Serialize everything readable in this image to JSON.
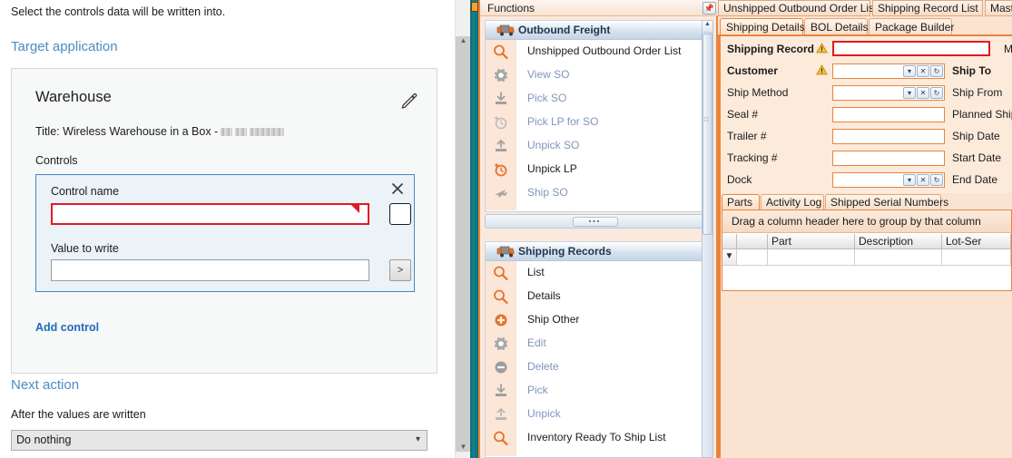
{
  "left_pane": {
    "intro_text": "Select the controls data will be written into.",
    "target_application_heading": "Target application",
    "card": {
      "title": "Warehouse",
      "edit_icon": "pencil-icon",
      "subtitle_prefix": "Title:  Wireless Warehouse in a Box -",
      "controls_label": "Controls",
      "control": {
        "close_icon": "close-x-icon",
        "name_label": "Control name",
        "name_value": "",
        "name_placeholder": "",
        "picker_button_icon": "element-picker-icon",
        "value_label": "Value to write",
        "value_value": "",
        "value_placeholder": "",
        "expand_button_label": ">"
      },
      "add_control_link": "Add control"
    },
    "next_action_heading": "Next action",
    "after_values_label": "After the values are written",
    "next_action_selected": "Do nothing",
    "next_action_options": [
      "Do nothing"
    ]
  },
  "functions_panel": {
    "title": "Functions",
    "pin_icon": "pin-icon",
    "groups": [
      {
        "title": "Outbound Freight",
        "icon": "truck-icon",
        "items": [
          {
            "label": "Unshipped Outbound Order List",
            "icon": "search-icon",
            "enabled": true
          },
          {
            "label": "View SO",
            "icon": "gear-icon",
            "enabled": false
          },
          {
            "label": "Pick SO",
            "icon": "download-tray-icon",
            "enabled": false
          },
          {
            "label": "Pick LP for SO",
            "icon": "clock-plus-icon",
            "enabled": false
          },
          {
            "label": "Unpick SO",
            "icon": "upload-tray-icon",
            "enabled": false
          },
          {
            "label": "Unpick LP",
            "icon": "clock-plus-icon",
            "enabled": true
          },
          {
            "label": "Ship SO",
            "icon": "airplane-icon",
            "enabled": false
          }
        ]
      },
      {
        "title": "Shipping Records",
        "icon": "truck-icon",
        "items": [
          {
            "label": "List",
            "icon": "search-icon",
            "enabled": true
          },
          {
            "label": "Details",
            "icon": "search-icon",
            "enabled": true
          },
          {
            "label": "Ship Other",
            "icon": "plus-circle-icon",
            "enabled": true
          },
          {
            "label": "Edit",
            "icon": "gear-icon",
            "enabled": false
          },
          {
            "label": "Delete",
            "icon": "minus-circle-icon",
            "enabled": false
          },
          {
            "label": "Pick",
            "icon": "download-tray-icon",
            "enabled": false
          },
          {
            "label": "Unpick",
            "icon": "upload-tray-icon",
            "enabled": false
          },
          {
            "label": "Inventory Ready To Ship List",
            "icon": "search-icon",
            "enabled": true
          }
        ]
      }
    ],
    "collapse_grip": "▪▪▪",
    "scroll_up_icon": "chevron-up-icon"
  },
  "right_panel": {
    "document_tabs": [
      {
        "label": "Unshipped Outbound Order List",
        "active": false
      },
      {
        "label": "Shipping Record List",
        "active": false
      },
      {
        "label": "Master Shi",
        "active": false
      }
    ],
    "inner_tabs": [
      {
        "label": "Shipping Details",
        "active": true
      },
      {
        "label": "BOL Details",
        "active": false
      },
      {
        "label": "Package Builder",
        "active": false
      }
    ],
    "form_left": [
      {
        "label": "Shipping Record",
        "bold": true,
        "warn": true,
        "type": "text-required",
        "value": ""
      },
      {
        "label": "Customer",
        "bold": true,
        "warn": true,
        "type": "lookup",
        "value": ""
      },
      {
        "label": "Ship Method",
        "bold": false,
        "warn": false,
        "type": "lookup",
        "value": ""
      },
      {
        "label": "Seal #",
        "bold": false,
        "warn": false,
        "type": "text",
        "value": ""
      },
      {
        "label": "Trailer #",
        "bold": false,
        "warn": false,
        "type": "text",
        "value": ""
      },
      {
        "label": "Tracking #",
        "bold": false,
        "warn": false,
        "type": "text",
        "value": ""
      },
      {
        "label": "Dock",
        "bold": false,
        "warn": false,
        "type": "lookup",
        "value": ""
      }
    ],
    "form_right": [
      {
        "label": "MS",
        "bold": false
      },
      {
        "label": "Ship To",
        "bold": true
      },
      {
        "label": "Ship From",
        "bold": false
      },
      {
        "label": "Planned Ship D",
        "bold": false
      },
      {
        "label": "Ship Date",
        "bold": false
      },
      {
        "label": "Start Date",
        "bold": false
      },
      {
        "label": "End Date",
        "bold": false
      }
    ],
    "lookup_buttons": [
      "dropdown-caret",
      "clear-x",
      "refresh"
    ],
    "grid_tabs": [
      {
        "label": "Parts",
        "active": true
      },
      {
        "label": "Activity Log",
        "active": false
      },
      {
        "label": "Shipped Serial Numbers",
        "active": false
      }
    ],
    "grid": {
      "group_hint": "Drag a column header here to group by that column",
      "columns": [
        "",
        "",
        "Part",
        "Description",
        "Lot-Ser"
      ],
      "filter_icon": "filter-icon",
      "rows": []
    }
  },
  "colors": {
    "accent_orange": "#e8853b",
    "required_red": "#e01b24",
    "link_blue": "#1e6bb8",
    "heading_blue": "#4a8bc2",
    "panel_peach": "#fce9dd",
    "teal_edge": "#14808c"
  }
}
